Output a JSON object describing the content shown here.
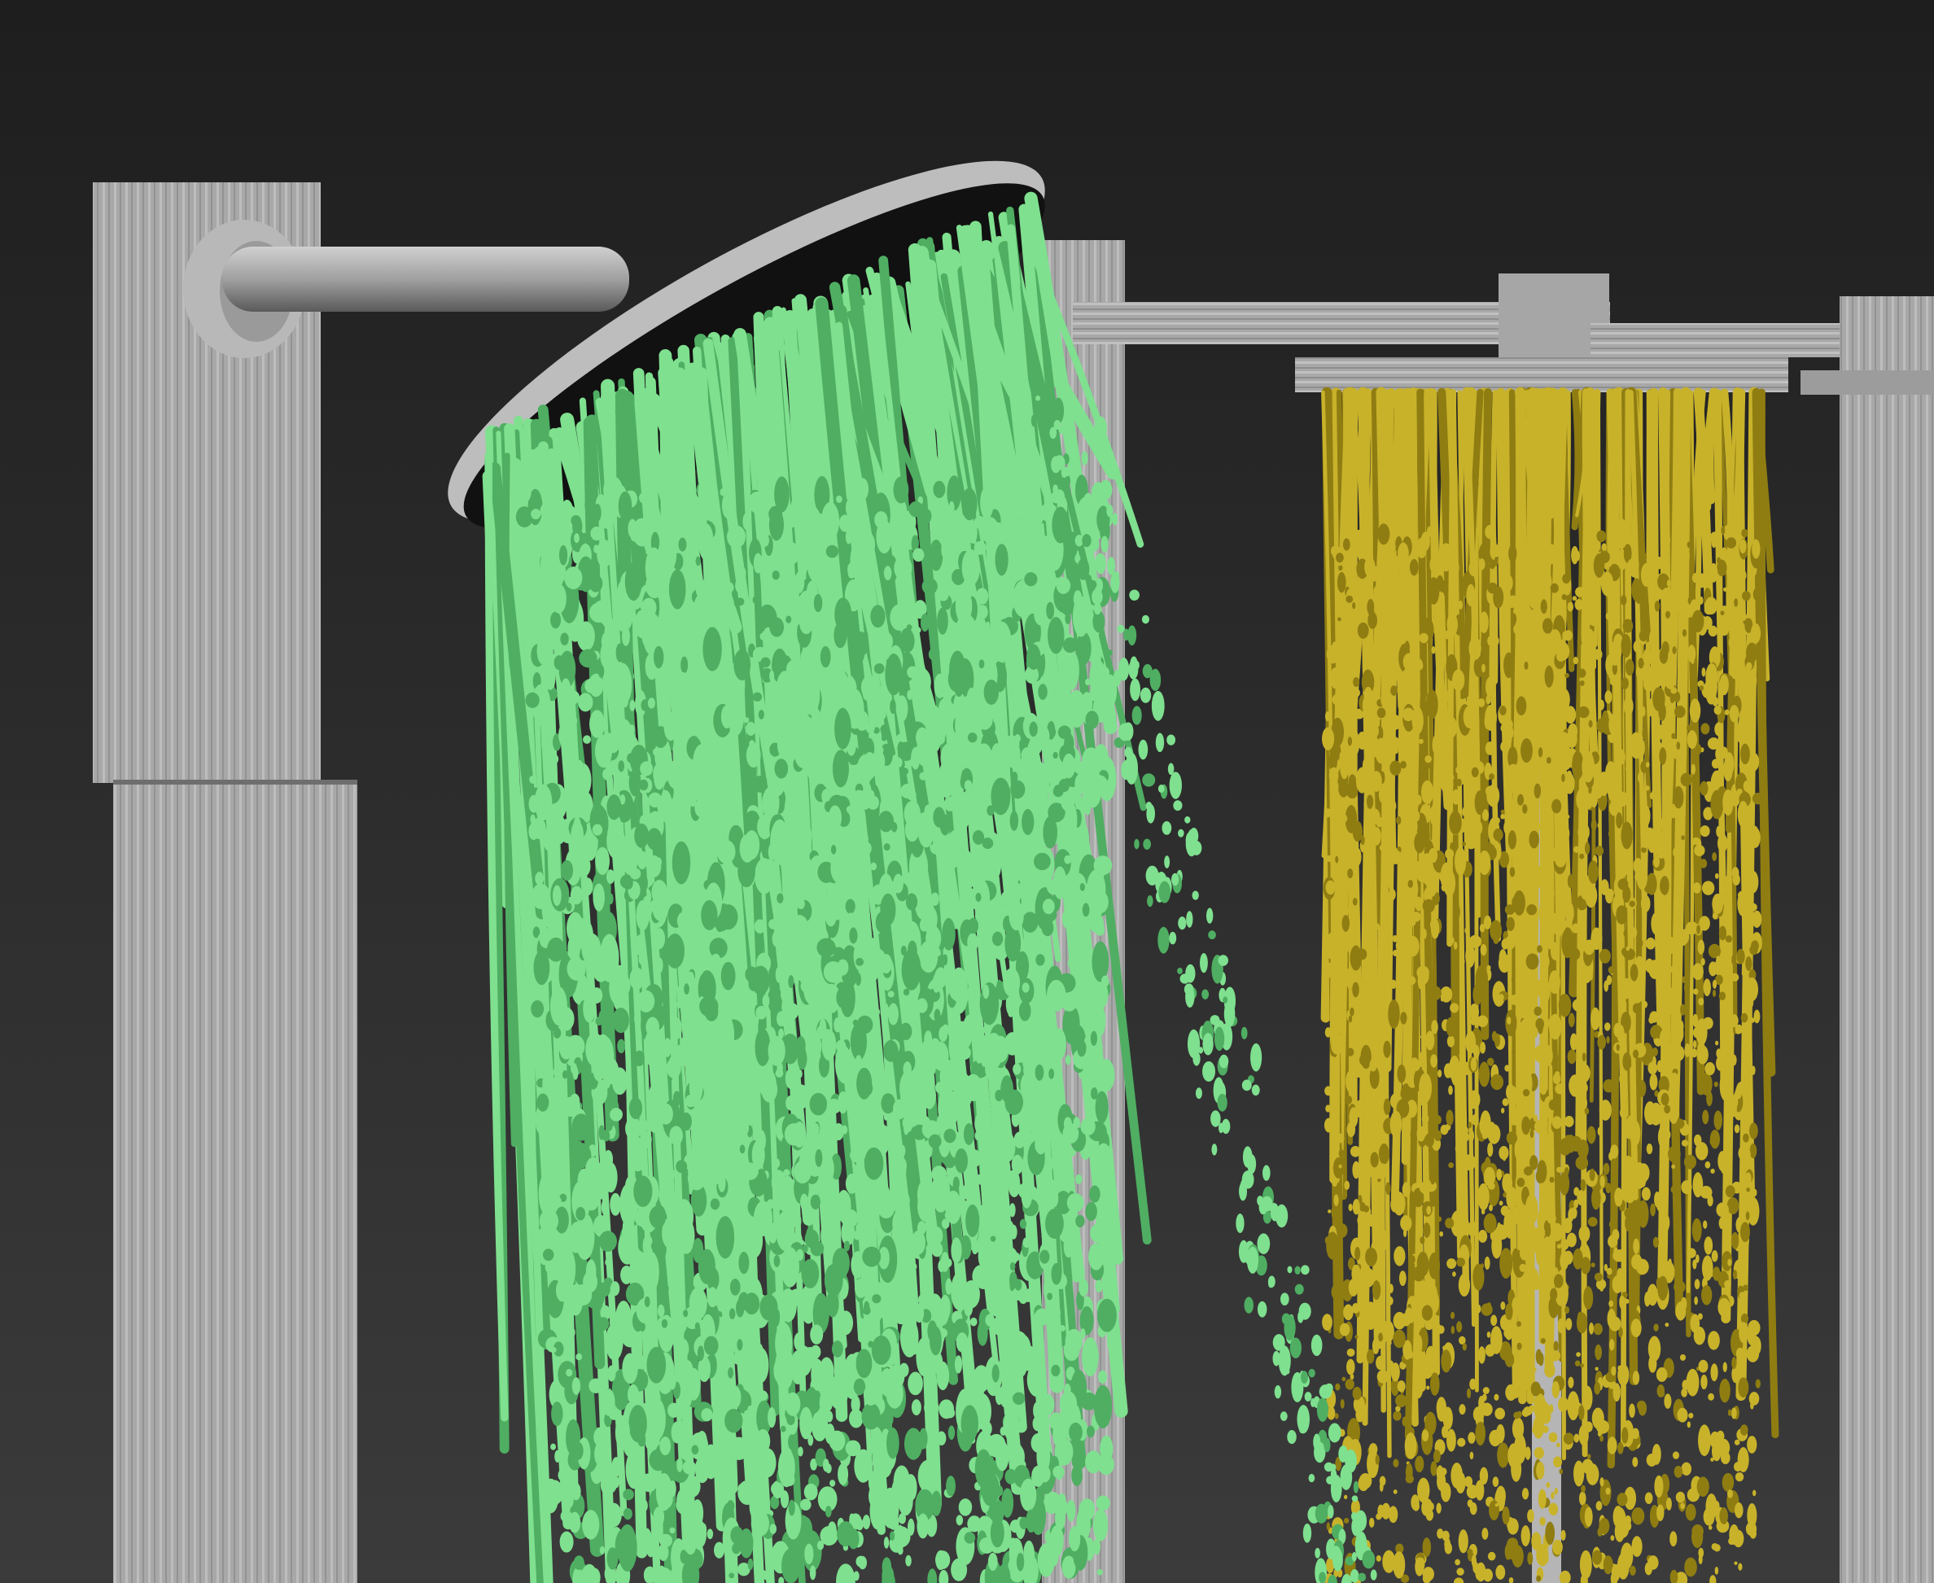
{
  "scene": {
    "colors": {
      "background_top": "#1e1e1e",
      "background_bottom": "#3b3b3b",
      "metal_light": "#c4c4c4",
      "metal_mid": "#a3a3a3",
      "metal_dark": "#7a7a7a",
      "shower_face": "#111111",
      "water_green": "#7fe08f",
      "water_green_shade": "#4fae62",
      "water_yellow": "#c8b22a",
      "water_yellow_shade": "#8f7d12"
    }
  }
}
